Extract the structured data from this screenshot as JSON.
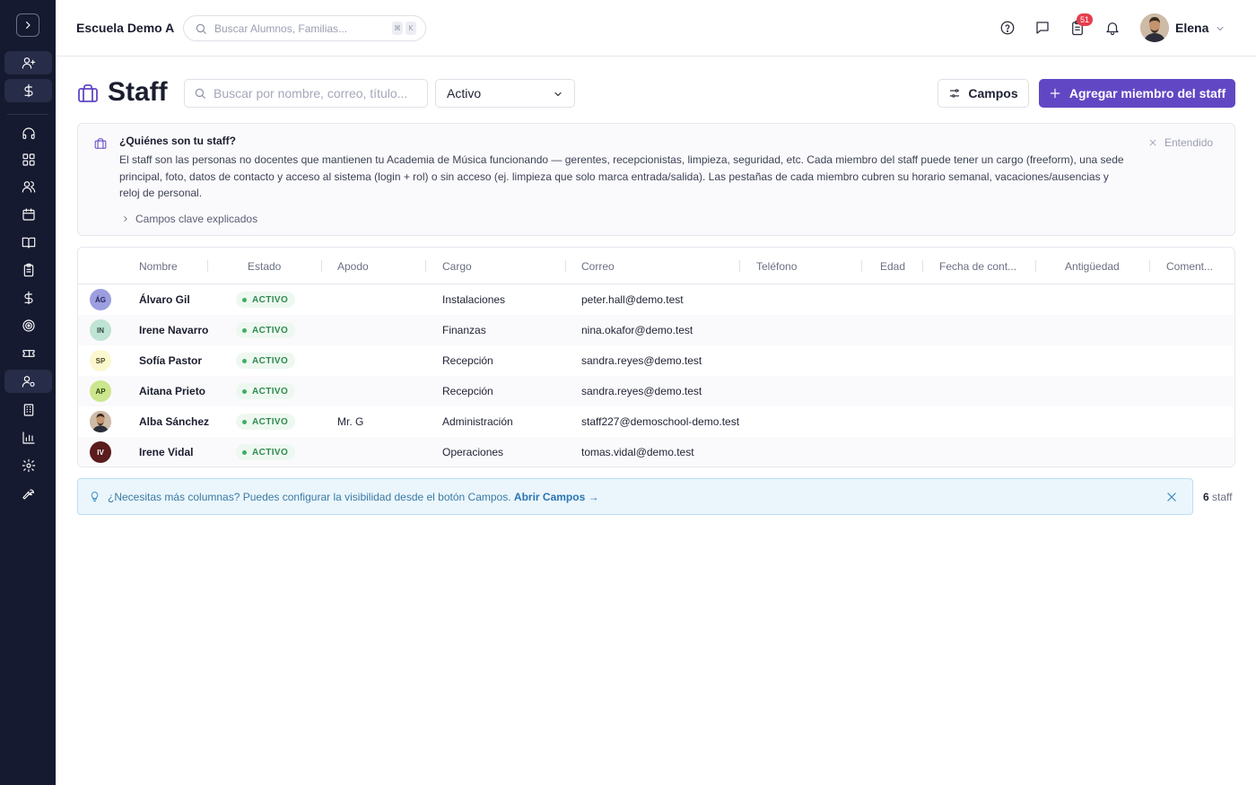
{
  "topbar": {
    "school_name": "Escuela Demo A",
    "search_placeholder": "Buscar Alumnos, Familias...",
    "shortcut_keys": [
      "⌘",
      "K"
    ],
    "notification_count": "51",
    "user_name": "Elena"
  },
  "sidebar": {
    "icons": [
      "chevron-right-icon",
      "user-plus-icon",
      "dollar-icon",
      "headset-icon",
      "grid-icon",
      "users-icon",
      "calendar-icon",
      "book-icon",
      "clipboard-icon",
      "dollar-icon",
      "target-icon",
      "ticket-icon",
      "user-cog-icon",
      "building-icon",
      "chart-icon",
      "gear-icon",
      "wrench-icon"
    ],
    "active_item": "staff"
  },
  "page": {
    "title": "Staff",
    "search_placeholder": "Buscar por nombre, correo, título...",
    "status_filter": "Activo",
    "fields_button": "Campos",
    "add_button": "Agregar miembro del staff"
  },
  "info": {
    "title": "¿Quiénes son tu staff?",
    "body": "El staff son las personas no docentes que mantienen tu Academia de Música funcionando — gerentes, recepcionistas, limpieza, seguridad, etc. Cada miembro del staff puede tener un cargo (freeform), una sede principal, foto, datos de contacto y acceso al sistema (login + rol) o sin acceso (ej. limpieza que solo marca entrada/salida). Las pestañas de cada miembro cubren su horario semanal, vacaciones/ausencias y reloj de personal.",
    "dismiss": "Entendido",
    "key_fields": "Campos clave explicados"
  },
  "table": {
    "columns": [
      "Nombre",
      "Estado",
      "Apodo",
      "Cargo",
      "Correo",
      "Teléfono",
      "Edad",
      "Fecha de cont...",
      "Antigüedad",
      "Coment..."
    ],
    "rows": [
      {
        "initials": "ÁG",
        "avatar_bg": "#9c9ee0",
        "avatar_fg": "#23265a",
        "name": "Álvaro Gil",
        "status": "ACTIVO",
        "nickname": "",
        "role": "Instalaciones",
        "email": "peter.hall@demo.test"
      },
      {
        "initials": "IN",
        "avatar_bg": "#bfe3d4",
        "avatar_fg": "#2a4a3c",
        "name": "Irene Navarro",
        "status": "ACTIVO",
        "nickname": "",
        "role": "Finanzas",
        "email": "nina.okafor@demo.test"
      },
      {
        "initials": "SP",
        "avatar_bg": "#fbf8cf",
        "avatar_fg": "#4b4620",
        "name": "Sofía Pastor",
        "status": "ACTIVO",
        "nickname": "",
        "role": "Recepción",
        "email": "sandra.reyes@demo.test"
      },
      {
        "initials": "AP",
        "avatar_bg": "#cbe68c",
        "avatar_fg": "#2f4512",
        "name": "Aitana Prieto",
        "status": "ACTIVO",
        "nickname": "",
        "role": "Recepción",
        "email": "sandra.reyes@demo.test"
      },
      {
        "initials": "",
        "avatar_bg": "#d7c7b5",
        "avatar_fg": "#222222",
        "name": "Alba Sánchez",
        "status": "ACTIVO",
        "nickname": "Mr. G",
        "role": "Administración",
        "email": "staff227@demoschool-demo.test"
      },
      {
        "initials": "IV",
        "avatar_bg": "#5a1c1c",
        "avatar_fg": "#ffffff",
        "name": "Irene Vidal",
        "status": "ACTIVO",
        "nickname": "",
        "role": "Operaciones",
        "email": "tomas.vidal@demo.test"
      }
    ]
  },
  "tip": {
    "text": "¿Necesitas más columnas? Puedes configurar la visibilidad desde el botón Campos. ",
    "link": "Abrir Campos →"
  },
  "footer": {
    "count": "6",
    "count_label": " staff"
  },
  "colors": {
    "sidebar_bg": "#161a30",
    "accent": "#6247c4",
    "status_green": "#2f8a4f",
    "badge_red": "#e53e4e"
  }
}
